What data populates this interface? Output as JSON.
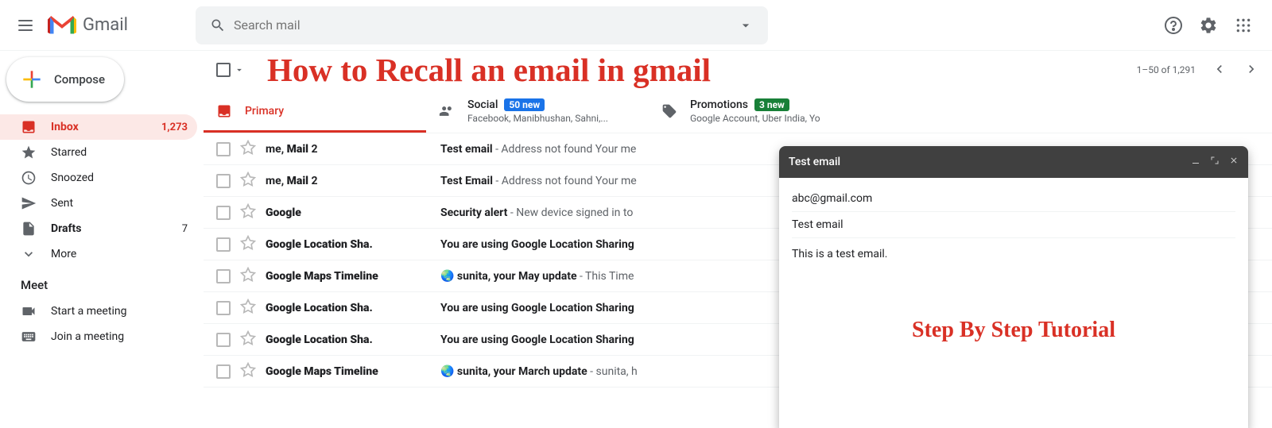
{
  "header": {
    "app_name": "Gmail",
    "search_placeholder": "Search mail"
  },
  "sidebar": {
    "compose_label": "Compose",
    "items": [
      {
        "label": "Inbox",
        "count": "1,273"
      },
      {
        "label": "Starred"
      },
      {
        "label": "Snoozed"
      },
      {
        "label": "Sent"
      },
      {
        "label": "Drafts",
        "count": "7"
      },
      {
        "label": "More"
      }
    ],
    "meet_header": "Meet",
    "meet_items": [
      {
        "label": "Start a meeting"
      },
      {
        "label": "Join a meeting"
      }
    ]
  },
  "toolbar": {
    "pagination_text": "1–50 of 1,291"
  },
  "overlay": {
    "heading": "How to Recall an email in gmail",
    "subheading": "Step By Step Tutorial"
  },
  "tabs": [
    {
      "label": "Primary"
    },
    {
      "label": "Social",
      "badge": "50 new",
      "sub": "Facebook, Manibhushan, Sahni,..."
    },
    {
      "label": "Promotions",
      "badge": "3 new",
      "sub": "Google Account, Uber India, Yo"
    }
  ],
  "emails": [
    {
      "sender_html": "me, <b>Mail</b> 2",
      "subject": "Test email",
      "snippet": " - Address not found Your me"
    },
    {
      "sender_html": "me, <b>Mail</b> 2",
      "subject": "Test Email",
      "snippet": " - Address not found Your me"
    },
    {
      "sender_html": "<b>Google</b>",
      "subject": "Security alert",
      "snippet": " - New device signed in to"
    },
    {
      "sender_html": "<b>Google Location Sha.</b>",
      "subject": "You are using Google Location Sharing",
      "snippet": ""
    },
    {
      "sender_html": "<b>Google Maps Timeline</b>",
      "subject": "🌏 sunita, your May update",
      "snippet": " - This Time"
    },
    {
      "sender_html": "<b>Google Location Sha.</b>",
      "subject": "You are using Google Location Sharing",
      "snippet": ""
    },
    {
      "sender_html": "<b>Google Location Sha.</b>",
      "subject": "You are using Google Location Sharing",
      "snippet": ""
    },
    {
      "sender_html": "<b>Google Maps Timeline</b>",
      "subject": "🌏 sunita, your March update",
      "snippet": " - sunita, h"
    }
  ],
  "compose_dialog": {
    "title": "Test email",
    "to": "abc@gmail.com",
    "subject": "Test email",
    "body": "This is a test email."
  }
}
